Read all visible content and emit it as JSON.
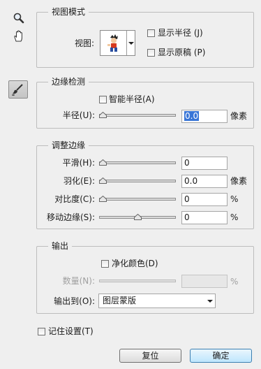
{
  "tools": {
    "zoom_icon": "magnifier-icon",
    "hand_icon": "hand-icon",
    "brush_icon": "refine-radius-brush-icon"
  },
  "view_mode": {
    "title": "视图模式",
    "view_label": "视图:",
    "show_radius": "显示半径 (J)",
    "show_original": "显示原稿 (P)"
  },
  "edge_detection": {
    "title": "边缘检测",
    "smart_radius": "智能半径(A)",
    "radius_label": "半径(U):",
    "radius_value": "0.0",
    "radius_unit": "像素",
    "radius_fraction": 0
  },
  "adjust_edge": {
    "title": "调整边缘",
    "smooth_label": "平滑(H):",
    "smooth_value": "0",
    "smooth_fraction": 0,
    "feather_label": "羽化(E):",
    "feather_value": "0.0",
    "feather_unit": "像素",
    "feather_fraction": 0,
    "contrast_label": "对比度(C):",
    "contrast_value": "0",
    "contrast_unit": "%",
    "contrast_fraction": 0,
    "shift_label": "移动边缘(S):",
    "shift_value": "0",
    "shift_unit": "%",
    "shift_fraction": 0.5
  },
  "output": {
    "title": "输出",
    "decontaminate": "净化颜色(D)",
    "amount_label": "数量(N):",
    "amount_value": "",
    "amount_unit": "%",
    "output_to_label": "输出到(O):",
    "output_to_value": "图层蒙版"
  },
  "remember": "记住设置(T)",
  "buttons": {
    "reset": "复位",
    "ok": "确定"
  }
}
